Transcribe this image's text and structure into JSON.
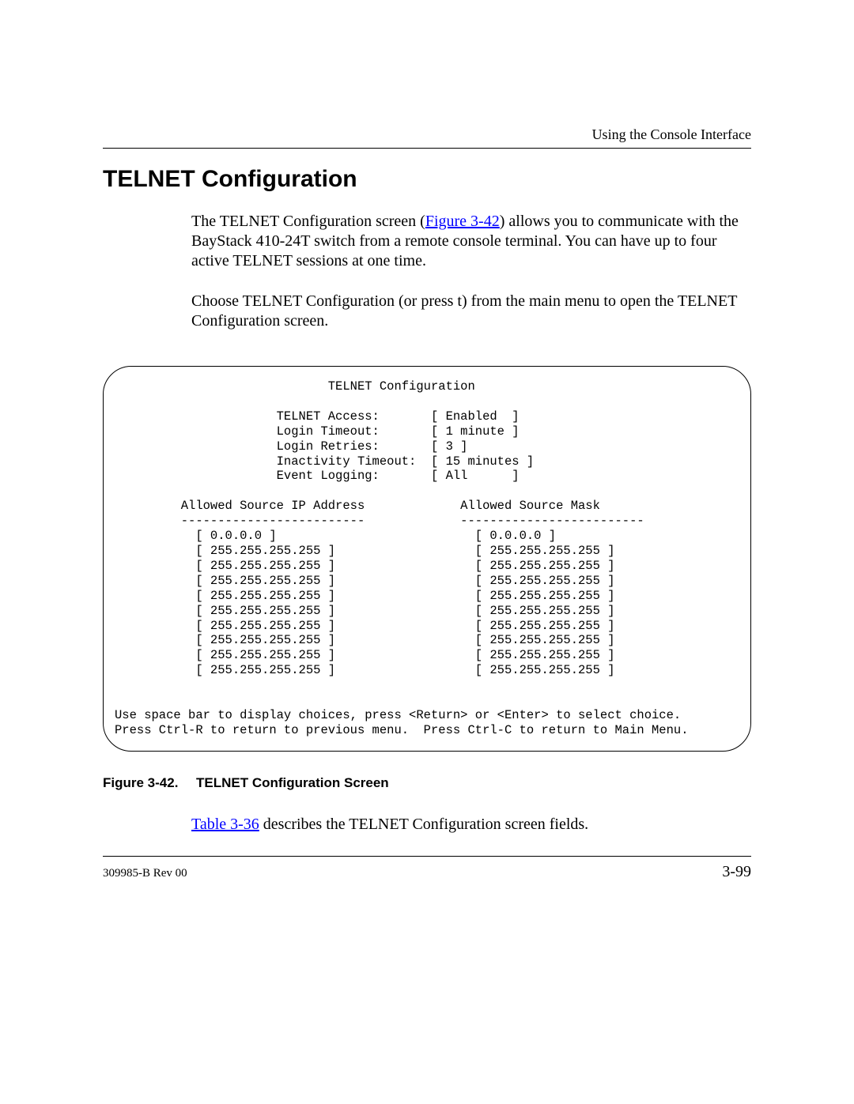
{
  "header": {
    "running_title": "Using the Console Interface"
  },
  "section": {
    "title": "TELNET Configuration"
  },
  "paragraphs": {
    "p1_a": "The TELNET Configuration screen (",
    "p1_link": "Figure 3-42",
    "p1_b": ") allows you to communicate with the BayStack 410-24T switch from a remote console terminal. You can have up to four active TELNET sessions at one time.",
    "p2": "Choose TELNET Configuration (or press t) from the main menu to open the TELNET Configuration screen."
  },
  "terminal": {
    "content": "                             TELNET Configuration\n\n                      TELNET Access:       [ Enabled  ]\n                      Login Timeout:       [ 1 minute ]\n                      Login Retries:       [ 3 ]\n                      Inactivity Timeout:  [ 15 minutes ]\n                      Event Logging:       [ All      ]\n\n         Allowed Source IP Address             Allowed Source Mask\n         -------------------------             -------------------------\n           [ 0.0.0.0 ]                           [ 0.0.0.0 ]\n           [ 255.255.255.255 ]                   [ 255.255.255.255 ]\n           [ 255.255.255.255 ]                   [ 255.255.255.255 ]\n           [ 255.255.255.255 ]                   [ 255.255.255.255 ]\n           [ 255.255.255.255 ]                   [ 255.255.255.255 ]\n           [ 255.255.255.255 ]                   [ 255.255.255.255 ]\n           [ 255.255.255.255 ]                   [ 255.255.255.255 ]\n           [ 255.255.255.255 ]                   [ 255.255.255.255 ]\n           [ 255.255.255.255 ]                   [ 255.255.255.255 ]\n           [ 255.255.255.255 ]                   [ 255.255.255.255 ]\n\n\nUse space bar to display choices, press <Return> or <Enter> to select choice.\nPress Ctrl-R to return to previous menu.  Press Ctrl-C to return to Main Menu."
  },
  "figure": {
    "label": "Figure 3-42.",
    "title": "TELNET Configuration Screen"
  },
  "after_figure": {
    "link": "Table 3-36",
    "rest": " describes the TELNET Configuration screen fields."
  },
  "footer": {
    "left": "309985-B Rev 00",
    "right": "3-99"
  }
}
